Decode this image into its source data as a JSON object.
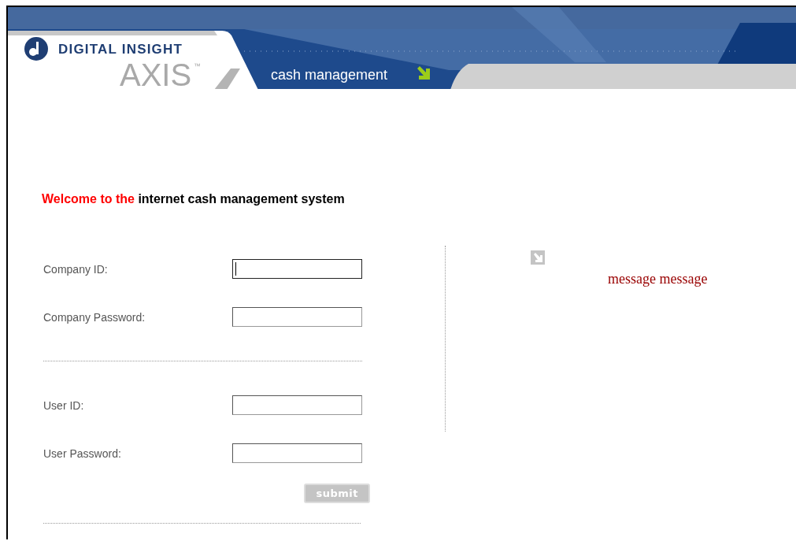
{
  "header": {
    "brand": "DIGITAL INSIGHT",
    "product": "AXIS",
    "trademark": "™",
    "section": "cash management"
  },
  "welcome": {
    "lead": "Welcome to the",
    "rest": "internet cash management system"
  },
  "company_fields": [
    {
      "label": "Company ID:",
      "focused": true
    },
    {
      "label": "Company Password:",
      "focused": false
    }
  ],
  "user_fields": [
    {
      "label": "User ID:",
      "focused": false
    },
    {
      "label": "User Password:",
      "focused": false
    }
  ],
  "submit": "submit",
  "message": "message message"
}
